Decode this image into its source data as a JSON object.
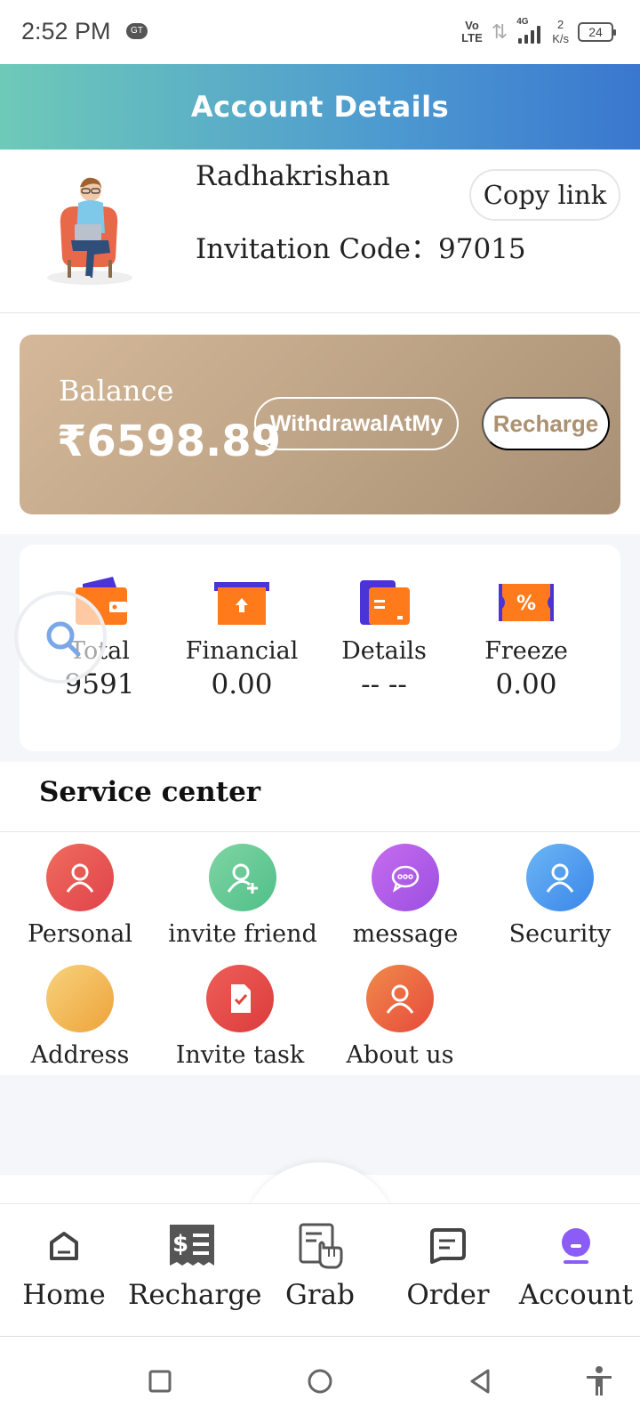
{
  "status_bar": {
    "time": "2:52 PM",
    "notif_badge": "GT",
    "volte": "Vo LTE",
    "network": "4G",
    "speed_value": "2",
    "speed_unit": "K/s",
    "battery": "24"
  },
  "header": {
    "title": "Account Details"
  },
  "profile": {
    "username": "Radhakrishan",
    "invitation_label": "Invitation Code：",
    "invitation_code": "97015",
    "copy_button": "Copy link",
    "avatar_icon": "avatar-illustration"
  },
  "balance": {
    "label": "Balance",
    "amount": "₹6598.89",
    "withdraw_button": "WithdrawalAtMy",
    "recharge_button": "Recharge"
  },
  "stats": [
    {
      "label": "Total",
      "value": "9591",
      "icon": "wallet-icon"
    },
    {
      "label": "Financial",
      "value": "0.00",
      "icon": "upload-box-icon"
    },
    {
      "label": "Details",
      "value": "-- --",
      "icon": "card-icon"
    },
    {
      "label": "Freeze",
      "value": "0.00",
      "icon": "coupon-icon"
    }
  ],
  "service_center": {
    "title": "Service center",
    "items": [
      {
        "label": "Personal",
        "icon": "user-icon",
        "color": "#e8524f"
      },
      {
        "label": "invite friend",
        "icon": "user-plus-icon",
        "color": "#5cc393"
      },
      {
        "label": "message",
        "icon": "chat-icon",
        "color": "#b65ce8"
      },
      {
        "label": "Security",
        "icon": "user-shield-icon",
        "color": "#4a9ef0"
      },
      {
        "label": "Address",
        "icon": "location-icon",
        "color": "#f2b34a"
      },
      {
        "label": "Invite task",
        "icon": "task-icon",
        "color": "#e84e4a"
      },
      {
        "label": "About us",
        "icon": "user-info-icon",
        "color": "#ef6a44"
      }
    ]
  },
  "bottom_nav": [
    {
      "label": "Home",
      "icon": "home-icon",
      "active": false
    },
    {
      "label": "Recharge",
      "icon": "receipt-dollar-icon",
      "active": false
    },
    {
      "label": "Grab",
      "icon": "grab-hand-icon",
      "active": false
    },
    {
      "label": "Order",
      "icon": "order-icon",
      "active": false
    },
    {
      "label": "Account",
      "icon": "account-icon",
      "active": true
    }
  ],
  "colors": {
    "header_gradient_start": "#6ecab8",
    "header_gradient_end": "#3a77cf",
    "balance_card": "#bda385",
    "active_nav": "#8b5cf6"
  }
}
